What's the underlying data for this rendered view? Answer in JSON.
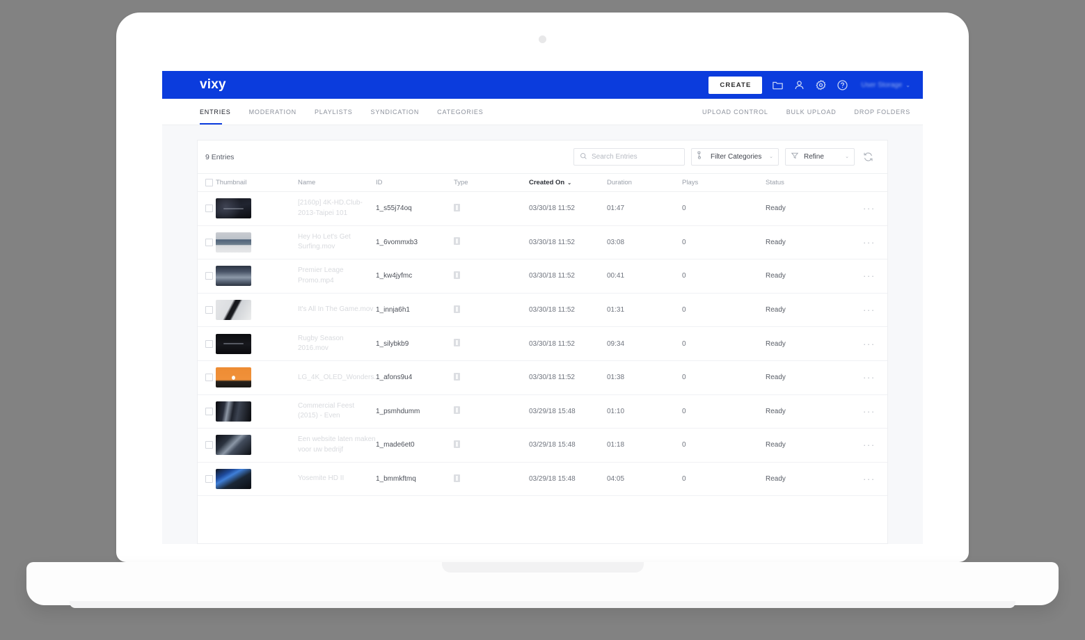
{
  "brand": {
    "name": "vixy"
  },
  "topbar": {
    "create_label": "CREATE",
    "icons": [
      "folder-icon",
      "user-icon",
      "gear-icon",
      "help-icon"
    ],
    "user_label": "User Storage",
    "user_chevron": "⌄",
    "background_color": "#0b3cdd"
  },
  "nav": {
    "left_items": [
      {
        "label": "ENTRIES",
        "active": true
      },
      {
        "label": "MODERATION",
        "active": false
      },
      {
        "label": "PLAYLISTS",
        "active": false
      },
      {
        "label": "SYNDICATION",
        "active": false
      },
      {
        "label": "CATEGORIES",
        "active": false
      }
    ],
    "right_items": [
      {
        "label": "UPLOAD CONTROL"
      },
      {
        "label": "BULK UPLOAD"
      },
      {
        "label": "DROP FOLDERS"
      }
    ]
  },
  "toolbar": {
    "entries_count": "9 Entries",
    "search_placeholder": "Search Entries",
    "search_value": "",
    "filter_categories_label": "Filter Categories",
    "refine_label": "Refine",
    "chevron": "⌄",
    "refresh_icon": "refresh-icon"
  },
  "table": {
    "columns": [
      {
        "key": "thumbnail",
        "label": "Thumbnail",
        "sorted": false
      },
      {
        "key": "name",
        "label": "Name",
        "sorted": false
      },
      {
        "key": "id",
        "label": "ID",
        "sorted": false
      },
      {
        "key": "type",
        "label": "Type",
        "sorted": false
      },
      {
        "key": "created_on",
        "label": "Created On",
        "sorted": true
      },
      {
        "key": "duration",
        "label": "Duration",
        "sorted": false
      },
      {
        "key": "plays",
        "label": "Plays",
        "sorted": false
      },
      {
        "key": "status",
        "label": "Status",
        "sorted": false
      }
    ],
    "sort_caret": "⌄",
    "action_dots": "···",
    "rows": [
      {
        "name": "[2160p] 4K-HD.Club-2013-Taipei 101",
        "id": "1_s55j74oq",
        "type_icon": "video-type-icon",
        "created_on": "03/30/18 11:52",
        "duration": "01:47",
        "plays": "0",
        "status": "Ready",
        "thumb_class": "t1"
      },
      {
        "name": "Hey Ho Let's Get Surfing.mov",
        "id": "1_6vommxb3",
        "type_icon": "video-type-icon",
        "created_on": "03/30/18 11:52",
        "duration": "03:08",
        "plays": "0",
        "status": "Ready",
        "thumb_class": "t2"
      },
      {
        "name": "Premier Leage Promo.mp4",
        "id": "1_kw4jyfmc",
        "type_icon": "video-type-icon",
        "created_on": "03/30/18 11:52",
        "duration": "00:41",
        "plays": "0",
        "status": "Ready",
        "thumb_class": "t3"
      },
      {
        "name": "It's All In The Game.mov",
        "id": "1_innja6h1",
        "type_icon": "video-type-icon",
        "created_on": "03/30/18 11:52",
        "duration": "01:31",
        "plays": "0",
        "status": "Ready",
        "thumb_class": "t4"
      },
      {
        "name": "Rugby Season 2016.mov",
        "id": "1_silybkb9",
        "type_icon": "video-type-icon",
        "created_on": "03/30/18 11:52",
        "duration": "09:34",
        "plays": "0",
        "status": "Ready",
        "thumb_class": "t5"
      },
      {
        "name": "LG_4K_OLED_Wonders.",
        "id": "1_afons9u4",
        "type_icon": "video-type-icon",
        "created_on": "03/30/18 11:52",
        "duration": "01:38",
        "plays": "0",
        "status": "Ready",
        "thumb_class": "t6"
      },
      {
        "name": "Commercial Feest (2015) - Even",
        "id": "1_psmhdumm",
        "type_icon": "video-type-icon",
        "created_on": "03/29/18 15:48",
        "duration": "01:10",
        "plays": "0",
        "status": "Ready",
        "thumb_class": "t7"
      },
      {
        "name": "Een website laten maken voor uw bedrijf",
        "id": "1_made6et0",
        "type_icon": "video-type-icon",
        "created_on": "03/29/18 15:48",
        "duration": "01:18",
        "plays": "0",
        "status": "Ready",
        "thumb_class": "t8"
      },
      {
        "name": "Yosemite HD II",
        "id": "1_bmmkftmq",
        "type_icon": "video-type-icon",
        "created_on": "03/29/18 15:48",
        "duration": "04:05",
        "plays": "0",
        "status": "Ready",
        "thumb_class": "t9"
      }
    ]
  }
}
